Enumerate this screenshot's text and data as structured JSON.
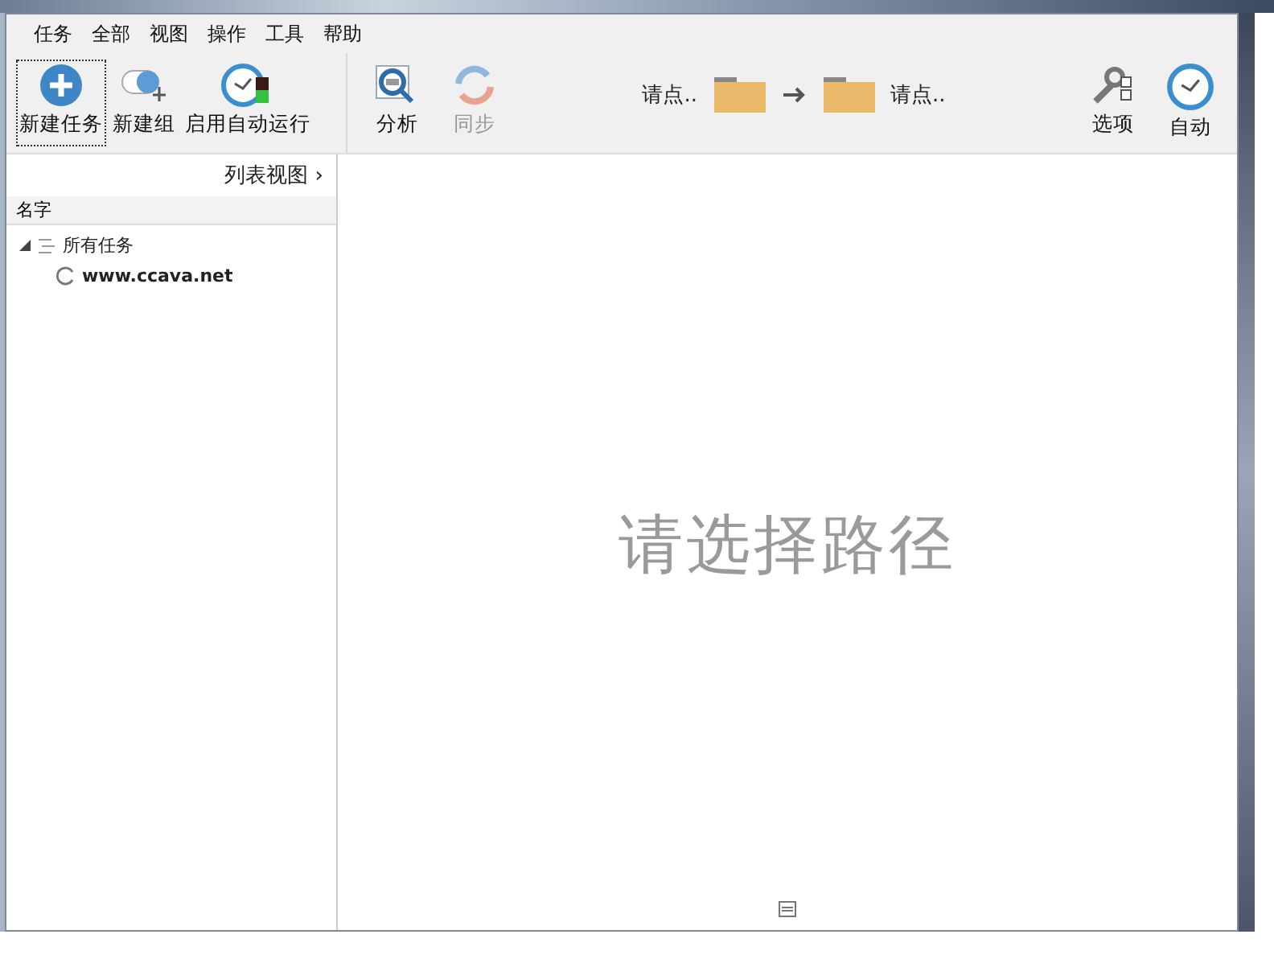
{
  "menu": [
    {
      "label": "任务"
    },
    {
      "label": "全部"
    },
    {
      "label": "视图"
    },
    {
      "label": "操作"
    },
    {
      "label": "工具"
    },
    {
      "label": "帮助"
    }
  ],
  "left_toolbar": [
    {
      "label": "新建任务",
      "kind": "new-task",
      "focused": true
    },
    {
      "label": "新建组",
      "kind": "new-group",
      "focused": false
    },
    {
      "label": "启用自动运行",
      "kind": "auto-run",
      "focused": false
    }
  ],
  "job_toolbar": [
    {
      "label": "分析",
      "kind": "analyze",
      "disabled": false
    },
    {
      "label": "同步",
      "kind": "sync",
      "disabled": true
    }
  ],
  "paths": {
    "left": "请点..",
    "right": "请点.."
  },
  "right_toolbar": [
    {
      "label": "选项",
      "kind": "options"
    },
    {
      "label": "自动",
      "kind": "auto"
    }
  ],
  "view_switch": {
    "label": "列表视图",
    "arrow": "›"
  },
  "column_header": "名字",
  "tree": [
    {
      "label": "所有任务",
      "expanded": true,
      "children": [
        {
          "label": "www.ccava.net"
        }
      ]
    }
  ],
  "placeholder_message": "请选择路径"
}
